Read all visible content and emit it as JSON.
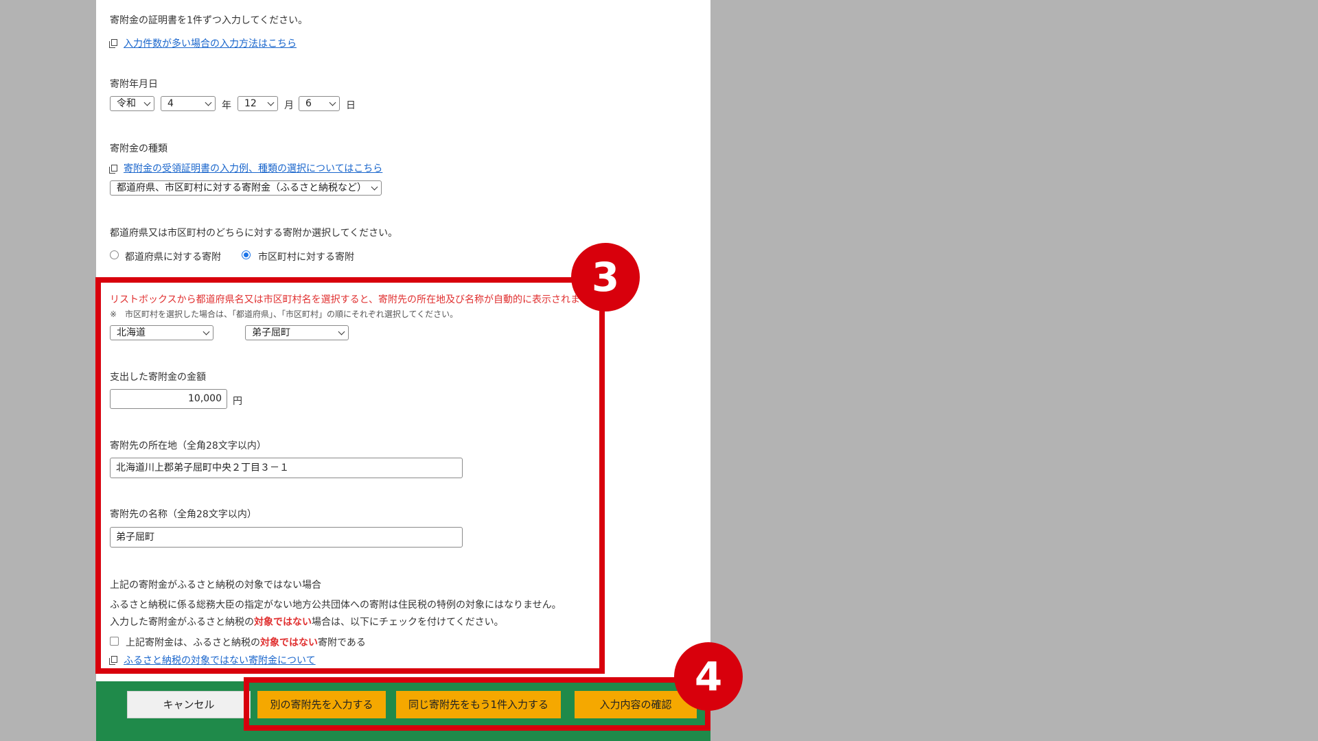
{
  "form": {
    "intro_text": "寄附金の証明書を1件ずつ入力してください。",
    "many_entries_link": "入力件数が多い場合の入力方法はこちら",
    "date_label": "寄附年月日",
    "era": "令和",
    "year": "4",
    "year_unit": "年",
    "month": "12",
    "month_unit": "月",
    "day": "6",
    "day_unit": "日",
    "type_label": "寄附金の種類",
    "type_help_link": "寄附金の受領証明書の入力例、種類の選択についてはこちら",
    "type_value": "都道府県、市区町村に対する寄附金（ふるさと納税など）",
    "target_question": "都道府県又は市区町村のどちらに対する寄附か選択してください。",
    "radio_prefecture": "都道府県に対する寄附",
    "radio_municipality": "市区町村に対する寄附",
    "listbox_notice": "リストボックスから都道府県名又は市区町村名を選択すると、寄附先の所在地及び名称が自動的に表示されます。",
    "listbox_note": "※　市区町村を選択した場合は、「都道府県」、「市区町村」の順にそれぞれ選択してください。",
    "prefecture_value": "北海道",
    "municipality_value": "弟子屈町",
    "amount_label": "支出した寄附金の金額",
    "amount_value": "10,000",
    "amount_unit": "円",
    "address_label": "寄附先の所在地（全角28文字以内）",
    "address_value": "北海道川上郡弟子屈町中央２丁目３－１",
    "name_label": "寄附先の名称（全角28文字以内）",
    "name_value": "弟子屈町",
    "not_target_heading": "上記の寄附金がふるさと納税の対象ではない場合",
    "not_target_desc": "ふるさと納税に係る総務大臣の指定がない地方公共団体への寄附は住民税の特例の対象にはなりません。",
    "not_target_instr_a": "入力した寄附金がふるさと納税の",
    "not_target_emph": "対象ではない",
    "not_target_instr_b": "場合は、以下にチェックを付けてください。",
    "checkbox_label_a": "上記寄附金は、ふるさと納税の",
    "checkbox_label_emph": "対象ではない",
    "checkbox_label_b": "寄附である",
    "not_target_link": "ふるさと納税の対象ではない寄附金について"
  },
  "footer": {
    "cancel": "キャンセル",
    "another_recipient": "別の寄附先を入力する",
    "same_recipient": "同じ寄附先をもう1件入力する",
    "confirm": "入力内容の確認"
  },
  "annotations": {
    "badge_3": "3",
    "badge_4": "4"
  },
  "colors": {
    "highlight_red": "#d8000c",
    "footer_green": "#1f8a4a",
    "button_yellow": "#f5a800",
    "notice_red": "#e03030",
    "link_blue": "#1a66cc"
  }
}
